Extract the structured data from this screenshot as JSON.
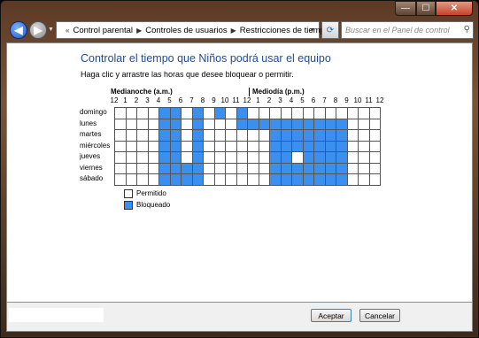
{
  "window": {
    "minimize": "—",
    "maximize": "☐",
    "close": "✕"
  },
  "breadcrumb": {
    "root_marker": "«",
    "items": [
      "Control parental",
      "Controles de usuarios",
      "Restricciones de tiempo"
    ]
  },
  "search": {
    "placeholder": "Buscar en el Panel de control"
  },
  "main": {
    "title": "Controlar el tiempo que Niños podrá usar el equipo",
    "instruction": "Haga clic y arrastre las horas que desee bloquear o permitir.",
    "header_am": "Medianoche (a.m.)",
    "header_pm": "Mediodía (p.m.)",
    "hour_labels": [
      "12",
      "1",
      "2",
      "3",
      "4",
      "5",
      "6",
      "7",
      "8",
      "9",
      "10",
      "11",
      "12",
      "1",
      "2",
      "3",
      "4",
      "5",
      "6",
      "7",
      "8",
      "9",
      "10",
      "11",
      "12"
    ],
    "days": [
      "domingo",
      "lunes",
      "martes",
      "miércoles",
      "jueves",
      "viernes",
      "sábado"
    ]
  },
  "schedule_blocked_hours": {
    "domingo": [
      4,
      5,
      7,
      9,
      11
    ],
    "lunes": [
      4,
      5,
      7,
      11,
      12,
      13,
      14,
      15,
      16,
      17,
      18,
      19,
      20
    ],
    "martes": [
      4,
      5,
      7,
      14,
      15,
      16,
      17,
      18,
      19,
      20
    ],
    "miércoles": [
      4,
      5,
      7,
      14,
      15,
      16,
      17,
      18,
      19,
      20
    ],
    "jueves": [
      4,
      5,
      7,
      14,
      15,
      17,
      18,
      19,
      20
    ],
    "viernes": [
      4,
      5,
      6,
      7,
      14,
      15,
      16,
      17,
      18,
      19,
      20
    ],
    "sábado": [
      4,
      5,
      6,
      7,
      14,
      15,
      16,
      17,
      18,
      19,
      20
    ]
  },
  "legend": {
    "allowed": "Permitido",
    "blocked": "Bloqueado"
  },
  "colors": {
    "blocked": "#3a8fef",
    "allowed": "#ffffff",
    "title": "#1e4c9a"
  },
  "buttons": {
    "accept": "Aceptar",
    "cancel": "Cancelar"
  }
}
